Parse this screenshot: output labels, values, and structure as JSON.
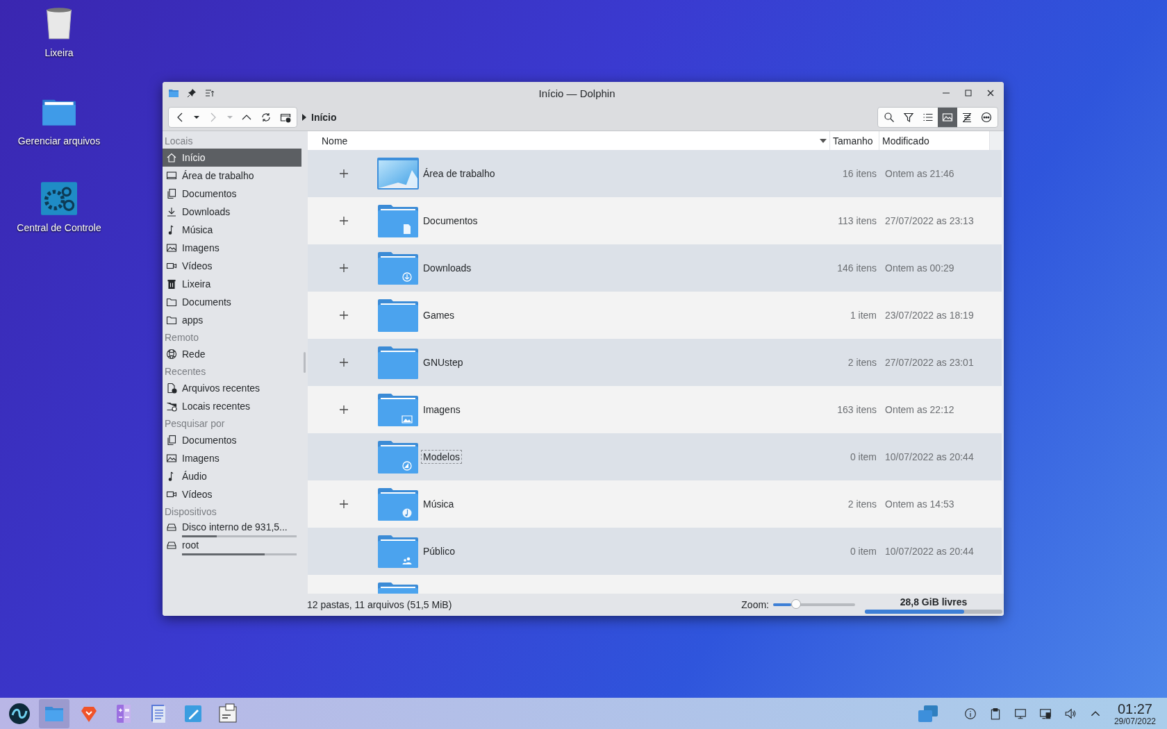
{
  "desktop_icons": [
    {
      "label": "Lixeira",
      "kind": "trash"
    },
    {
      "label": "Gerenciar arquivos",
      "kind": "folder"
    },
    {
      "label": "Central de Controle",
      "kind": "control"
    }
  ],
  "window": {
    "title": "Início — Dolphin"
  },
  "toolbar": {
    "nav_buttons": [
      {
        "kind": "back",
        "disabled": false
      },
      {
        "kind": "back-menu",
        "disabled": false
      },
      {
        "kind": "forward",
        "disabled": true
      },
      {
        "kind": "forward-menu",
        "disabled": true
      },
      {
        "kind": "up",
        "disabled": false
      },
      {
        "kind": "reload",
        "disabled": false
      },
      {
        "kind": "new-tab",
        "disabled": false
      }
    ],
    "breadcrumb": "Início",
    "view_buttons": [
      {
        "kind": "search",
        "selected": false
      },
      {
        "kind": "filter",
        "selected": false
      },
      {
        "kind": "list",
        "selected": false
      },
      {
        "kind": "preview",
        "selected": true
      },
      {
        "kind": "details",
        "selected": false
      },
      {
        "kind": "more",
        "selected": false
      }
    ]
  },
  "sidebar": {
    "sections": [
      {
        "title": "Locais",
        "items": [
          {
            "label": "Início",
            "kind": "home",
            "selected": true
          },
          {
            "label": "Área de trabalho",
            "kind": "monitor",
            "selected": false
          },
          {
            "label": "Documentos",
            "kind": "documents",
            "selected": false
          },
          {
            "label": "Downloads",
            "kind": "download",
            "selected": false
          },
          {
            "label": "Música",
            "kind": "music",
            "selected": false
          },
          {
            "label": "Imagens",
            "kind": "image",
            "selected": false
          },
          {
            "label": "Vídeos",
            "kind": "video",
            "selected": false
          },
          {
            "label": "Lixeira",
            "kind": "trash",
            "selected": false
          },
          {
            "label": "Documents",
            "kind": "folder",
            "selected": false
          },
          {
            "label": "apps",
            "kind": "folder",
            "selected": false
          }
        ]
      },
      {
        "title": "Remoto",
        "items": [
          {
            "label": "Rede",
            "kind": "network",
            "selected": false
          }
        ]
      },
      {
        "title": "Recentes",
        "items": [
          {
            "label": "Arquivos recentes",
            "kind": "recent-file",
            "selected": false
          },
          {
            "label": "Locais recentes",
            "kind": "recent-folder",
            "selected": false
          }
        ]
      },
      {
        "title": "Pesquisar por",
        "items": [
          {
            "label": "Documentos",
            "kind": "documents",
            "selected": false
          },
          {
            "label": "Imagens",
            "kind": "image",
            "selected": false
          },
          {
            "label": "Áudio",
            "kind": "music",
            "selected": false
          },
          {
            "label": "Vídeos",
            "kind": "video",
            "selected": false
          }
        ]
      },
      {
        "title": "Dispositivos",
        "items": [
          {
            "label": "Disco interno de 931,5...",
            "kind": "drive",
            "selected": false,
            "level": 0.3
          },
          {
            "label": "root",
            "kind": "drive",
            "selected": false,
            "level": 0.72
          }
        ]
      }
    ]
  },
  "table": {
    "columns": [
      {
        "label": "Nome",
        "sorted": true
      },
      {
        "label": "Tamanho",
        "sorted": false
      },
      {
        "label": "Modificado",
        "sorted": false
      }
    ],
    "rows": [
      {
        "name": "Área de trabalho",
        "size": "16 itens",
        "modified": "Ontem as 21:46",
        "kind": "desktop",
        "expandable": true,
        "focused": false
      },
      {
        "name": "Documentos",
        "size": "113 itens",
        "modified": "27/07/2022 as 23:13",
        "kind": "documents",
        "expandable": true,
        "focused": false
      },
      {
        "name": "Downloads",
        "size": "146 itens",
        "modified": "Ontem as 00:29",
        "kind": "download",
        "expandable": true,
        "focused": false
      },
      {
        "name": "Games",
        "size": "1 item",
        "modified": "23/07/2022 as 18:19",
        "kind": "plain",
        "expandable": true,
        "focused": false
      },
      {
        "name": "GNUstep",
        "size": "2 itens",
        "modified": "27/07/2022 as 23:01",
        "kind": "plain",
        "expandable": true,
        "focused": false
      },
      {
        "name": "Imagens",
        "size": "163 itens",
        "modified": "Ontem as 22:12",
        "kind": "image",
        "expandable": true,
        "focused": false
      },
      {
        "name": "Modelos",
        "size": "0 item",
        "modified": "10/07/2022 as 20:44",
        "kind": "template",
        "expandable": false,
        "focused": true
      },
      {
        "name": "Música",
        "size": "2 itens",
        "modified": "Ontem as 14:53",
        "kind": "music",
        "expandable": true,
        "focused": false
      },
      {
        "name": "Público",
        "size": "0 item",
        "modified": "10/07/2022 as 20:44",
        "kind": "public",
        "expandable": false,
        "focused": false
      },
      {
        "kind": "plain"
      }
    ]
  },
  "status_bar": {
    "summary": "12 pastas, 11 arquivos (51,5 MiB)",
    "zoom_label": "Zoom:",
    "zoom": {
      "level": 0.22
    },
    "free_space": {
      "label": "28,8 GiB livres",
      "level": 0.72
    }
  },
  "taskbar": {
    "apps": [
      {
        "kind": "launcher",
        "selected": false
      },
      {
        "kind": "files",
        "selected": true
      },
      {
        "kind": "browser",
        "selected": false
      },
      {
        "kind": "calculator",
        "selected": false
      },
      {
        "kind": "document",
        "selected": false
      },
      {
        "kind": "editor",
        "selected": false
      },
      {
        "kind": "control",
        "selected": false
      }
    ],
    "tray": [
      {
        "kind": "windows"
      },
      {
        "kind": "info"
      },
      {
        "kind": "clipboard"
      },
      {
        "kind": "display"
      },
      {
        "kind": "network"
      },
      {
        "kind": "volume"
      },
      {
        "kind": "expand"
      }
    ],
    "time": "01:27",
    "date": "29/07/2022"
  }
}
